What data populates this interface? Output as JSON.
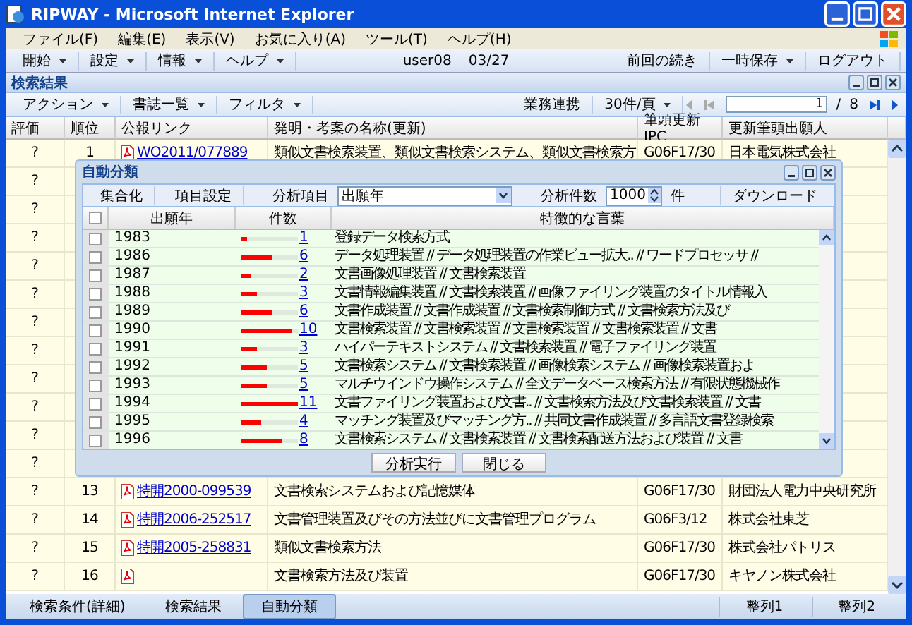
{
  "window": {
    "title": "RIPWAY - Microsoft Internet Explorer"
  },
  "menu": [
    "ファイル(F)",
    "編集(E)",
    "表示(V)",
    "お気に入り(A)",
    "ツール(T)",
    "ヘルプ(H)"
  ],
  "app_toolbar": {
    "menus": [
      "開始",
      "設定",
      "情報",
      "ヘルプ"
    ],
    "user": "user08",
    "date": "03/27",
    "right": [
      {
        "label": "前回の続き",
        "dropdown": false
      },
      {
        "label": "一時保存",
        "dropdown": true
      },
      {
        "label": "ログアウト",
        "dropdown": false
      }
    ]
  },
  "panel": {
    "title": "検索結果",
    "toolbar": {
      "menus": [
        "アクション",
        "書誌一覧",
        "フィルタ"
      ],
      "link_button": "業務連携",
      "per_page": "30件/頁",
      "page": "1",
      "page_sep": "/",
      "pages": "8"
    },
    "columns": [
      "評価",
      "順位",
      "公報リンク",
      "発明・考案の名称(更新)",
      "筆頭更新IPC",
      "更新筆頭出願人"
    ],
    "rows": [
      {
        "rating": "?",
        "rank": "1",
        "link": "WO2011/077889",
        "title": "類似文書検索装置、類似文書検索システム、類似文書検索方",
        "ipc": "G06F17/30",
        "applicant": "日本電気株式会社"
      },
      {
        "rating": "?"
      },
      {
        "rating": "?"
      },
      {
        "rating": "?"
      },
      {
        "rating": "?"
      },
      {
        "rating": "?"
      },
      {
        "rating": "?"
      },
      {
        "rating": "?"
      },
      {
        "rating": "?"
      },
      {
        "rating": "?"
      },
      {
        "rating": "?"
      },
      {
        "rating": "?"
      },
      {
        "rating": "?",
        "rank": "13",
        "link": "特開2000-099539",
        "title": "文書検索システムおよび記憶媒体",
        "ipc": "G06F17/30",
        "applicant": "財団法人電力中央研究所"
      },
      {
        "rating": "?",
        "rank": "14",
        "link": "特開2006-252517",
        "title": "文書管理装置及びその方法並びに文書管理プログラム",
        "ipc": "G06F3/12",
        "applicant": "株式会社東芝"
      },
      {
        "rating": "?",
        "rank": "15",
        "link": "特開2005-258831",
        "title": "類似文書検索方法",
        "ipc": "G06F17/30",
        "applicant": "株式会社パトリス"
      },
      {
        "rating": "?",
        "rank": "16",
        "title": "文書検索方法及び装置",
        "ipc": "G06F17/30",
        "applicant": "キヤノン株式会社"
      }
    ]
  },
  "dialog": {
    "title": "自動分類",
    "toolbar": {
      "buttons": [
        "集合化",
        "項目設定"
      ],
      "item_label": "分析項目",
      "item_value": "出願年",
      "count_label": "分析件数",
      "count_value": "1000",
      "count_unit": "件",
      "download": "ダウンロード"
    },
    "columns": [
      "出願年",
      "件数",
      "特徴的な言葉"
    ],
    "all_checked": false,
    "rows": [
      {
        "year": "1983",
        "count": "1",
        "level": 0.09,
        "checked": false,
        "words": "登録データ検索方式"
      },
      {
        "year": "1986",
        "count": "6",
        "level": 0.55,
        "checked": false,
        "words": "データ処理装置 // データ処理装置の作業ビュー拡大.. // ワードプロセッサ //"
      },
      {
        "year": "1987",
        "count": "2",
        "level": 0.18,
        "checked": false,
        "words": "文書画像処理装置 // 文書検索装置"
      },
      {
        "year": "1988",
        "count": "3",
        "level": 0.27,
        "checked": false,
        "words": "文書情報編集装置 // 文書検索装置 // 画像ファイリング装置のタイトル情報入"
      },
      {
        "year": "1989",
        "count": "6",
        "level": 0.55,
        "checked": false,
        "words": "文書作成装置 // 文書作成装置 // 文書検索制御方式 // 文書検索方法及び"
      },
      {
        "year": "1990",
        "count": "10",
        "level": 0.91,
        "checked": false,
        "words": "文書検索装置 // 文書検索装置 // 文書検索装置 // 文書検索装置 // 文書"
      },
      {
        "year": "1991",
        "count": "3",
        "level": 0.27,
        "checked": false,
        "words": "ハイパーテキストシステム // 文書検索装置 // 電子ファイリング装置"
      },
      {
        "year": "1992",
        "count": "5",
        "level": 0.45,
        "checked": false,
        "words": "文書検索システム // 文書検索装置 // 画像検索システム // 画像検索装置およ"
      },
      {
        "year": "1993",
        "count": "5",
        "level": 0.45,
        "checked": false,
        "words": "マルチウインドウ操作システム // 全文データベース検索方法 // 有限状態機械作"
      },
      {
        "year": "1994",
        "count": "11",
        "level": 1,
        "checked": false,
        "words": "文書ファイリング装置および文書.. // 文書検索方法及び文書検索装置 // 文書"
      },
      {
        "year": "1995",
        "count": "4",
        "level": 0.36,
        "checked": false,
        "words": "マッチング装置及びマッチング方.. // 共同文書作成装置 // 多言語文書登録検索"
      },
      {
        "year": "1996",
        "count": "8",
        "level": 0.73,
        "checked": false,
        "words": "文書検索システム // 文書検索装置 // 文書検索配送方法および装置 // 文書"
      }
    ],
    "buttons": [
      "分析実行",
      "閉じる"
    ]
  },
  "bottom_tabs": [
    {
      "label": "検索条件(詳細)",
      "selected": false
    },
    {
      "label": "検索結果",
      "selected": false
    },
    {
      "label": "自動分類",
      "selected": true
    }
  ],
  "bottom_right": [
    "整列1",
    "整列2"
  ]
}
